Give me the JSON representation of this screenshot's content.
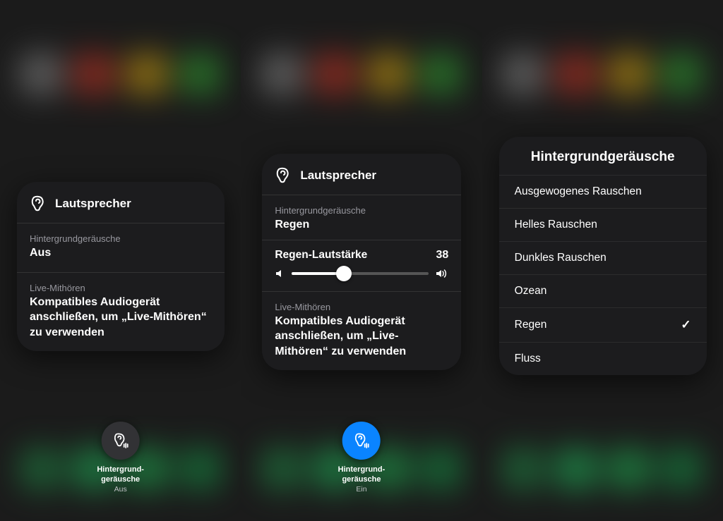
{
  "panel1": {
    "header_title": "Lautsprecher",
    "bg_label": "Hintergrundgeräusche",
    "bg_value": "Aus",
    "live_label": "Live-Mithören",
    "live_value": "Kompatibles Audiogerät anschließen, um „Live-Mithören“ zu verwenden",
    "cc_line1": "Hintergrund-",
    "cc_line2": "geräusche",
    "cc_status": "Aus"
  },
  "panel2": {
    "header_title": "Lautsprecher",
    "bg_label": "Hintergrundgeräusche",
    "bg_value": "Regen",
    "slider_label": "Regen-Lautstärke",
    "slider_value": "38",
    "slider_percent": 38,
    "live_label": "Live-Mithören",
    "live_value": "Kompatibles Audiogerät anschließen, um „Live-Mithören“ zu verwenden",
    "cc_line1": "Hintergrund-",
    "cc_line2": "geräusche",
    "cc_status": "Ein"
  },
  "panel3": {
    "title": "Hintergrundgeräusche",
    "items": [
      {
        "label": "Ausgewogenes Rauschen",
        "selected": false
      },
      {
        "label": "Helles Rauschen",
        "selected": false
      },
      {
        "label": "Dunkles Rauschen",
        "selected": false
      },
      {
        "label": "Ozean",
        "selected": false
      },
      {
        "label": "Regen",
        "selected": true
      },
      {
        "label": "Fluss",
        "selected": false
      }
    ]
  },
  "colors": {
    "blur_top": [
      "#6b6b6b",
      "#b03222",
      "#b68f10",
      "#2b8f2b"
    ],
    "blur_bot": [
      "#1e6c3a",
      "#1e8440",
      "#1e8040",
      "#17733a"
    ]
  }
}
